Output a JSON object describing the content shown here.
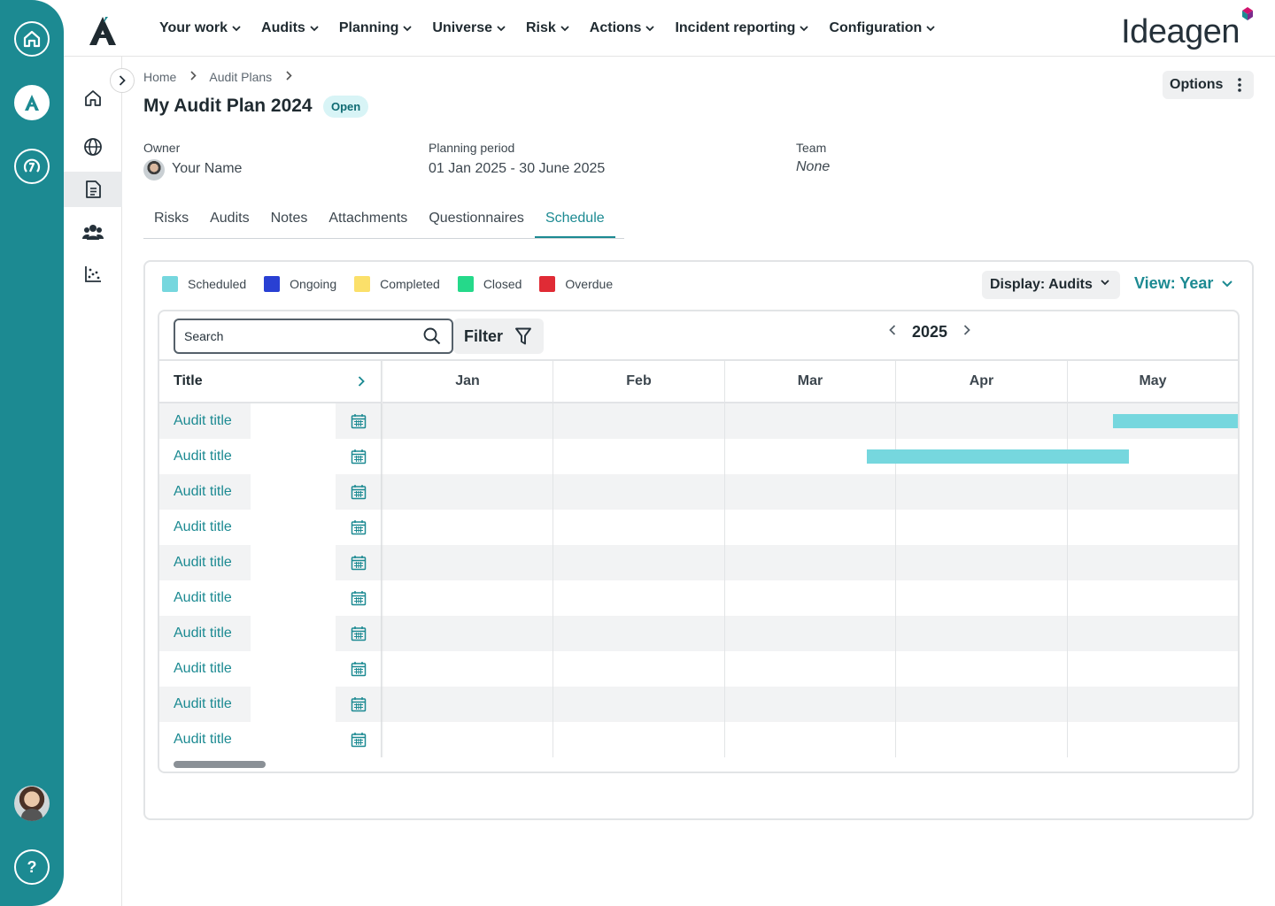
{
  "app": {
    "brand": "Ideagen",
    "colors": {
      "rail": "#1c8a92",
      "accent": "#1c8a92"
    }
  },
  "rail": {
    "items": [
      {
        "icon": "home-outline-icon"
      },
      {
        "icon": "audit-app-icon"
      },
      {
        "icon": "risk-app-icon"
      }
    ],
    "help_label": "?"
  },
  "topnav": {
    "items": [
      {
        "label": "Your work"
      },
      {
        "label": "Audits"
      },
      {
        "label": "Planning"
      },
      {
        "label": "Universe"
      },
      {
        "label": "Risk"
      },
      {
        "label": "Actions"
      },
      {
        "label": "Incident reporting"
      },
      {
        "label": "Configuration"
      }
    ]
  },
  "sidebar": {
    "items": [
      {
        "icon": "home-icon"
      },
      {
        "icon": "globe-icon"
      },
      {
        "icon": "document-icon",
        "active": true
      },
      {
        "icon": "people-icon"
      },
      {
        "icon": "scatter-chart-icon"
      }
    ]
  },
  "breadcrumb": [
    "Home",
    "Audit Plans"
  ],
  "page": {
    "title": "My Audit Plan 2024",
    "status": "Open",
    "options_label": "Options",
    "owner_label": "Owner",
    "owner_value": "Your Name",
    "period_label": "Planning period",
    "period_value": "01 Jan 2025 - 30 June 2025",
    "team_label": "Team",
    "team_value": "None"
  },
  "tabs": [
    {
      "label": "Risks"
    },
    {
      "label": "Audits"
    },
    {
      "label": "Notes"
    },
    {
      "label": "Attachments"
    },
    {
      "label": "Questionnaires"
    },
    {
      "label": "Schedule",
      "active": true
    }
  ],
  "schedule": {
    "legend": [
      {
        "label": "Scheduled",
        "color": "#76d7de"
      },
      {
        "label": "Ongoing",
        "color": "#2940d3"
      },
      {
        "label": "Completed",
        "color": "#fbe06a"
      },
      {
        "label": "Closed",
        "color": "#25d98a"
      },
      {
        "label": "Overdue",
        "color": "#e02b35"
      }
    ],
    "display_label": "Display: Audits",
    "view_label": "View: Year",
    "search_placeholder": "Search",
    "filter_label": "Filter",
    "year": "2025",
    "title_column": "Title",
    "months": [
      "Jan",
      "Feb",
      "Mar",
      "Apr",
      "May"
    ],
    "rows": [
      {
        "title": "Audit title"
      },
      {
        "title": "Audit title"
      },
      {
        "title": "Audit title"
      },
      {
        "title": "Audit title"
      },
      {
        "title": "Audit title"
      },
      {
        "title": "Audit title"
      },
      {
        "title": "Audit title"
      },
      {
        "title": "Audit title"
      },
      {
        "title": "Audit title"
      },
      {
        "title": "Audit title"
      }
    ],
    "bars": [
      {
        "row": 0,
        "status": "Scheduled",
        "start_month": 4.27,
        "end_month": 5.0
      },
      {
        "row": 1,
        "status": "Scheduled",
        "start_month": 2.83,
        "end_month": 4.36
      }
    ]
  }
}
